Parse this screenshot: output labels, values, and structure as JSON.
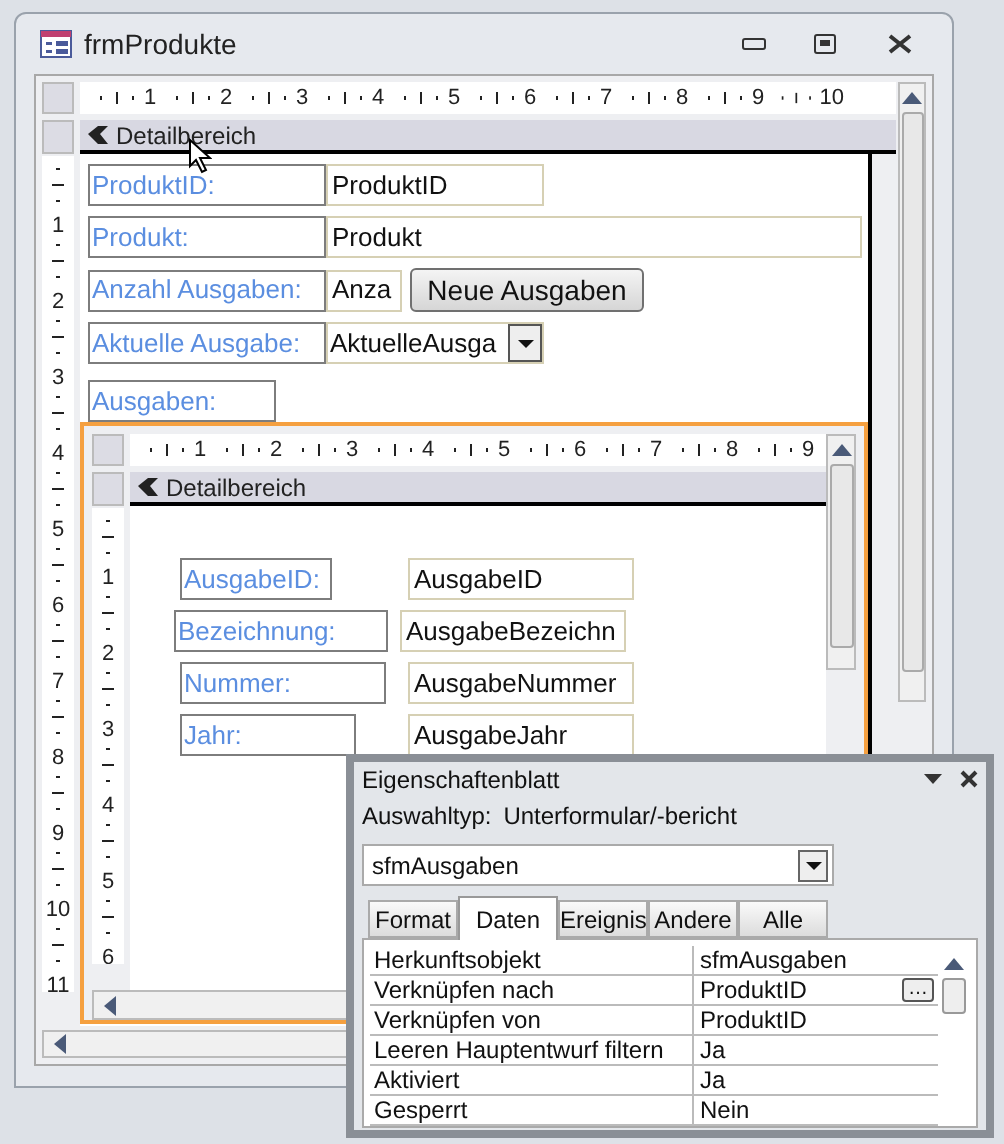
{
  "window": {
    "title": "frmProdukte"
  },
  "main_form": {
    "ruler_h": [
      "1",
      "2",
      "3",
      "4",
      "5",
      "6",
      "7",
      "8",
      "9",
      "10"
    ],
    "ruler_v": [
      "1",
      "2",
      "3",
      "4",
      "5",
      "6",
      "7",
      "8",
      "9",
      "10",
      "11"
    ],
    "section": "Detailbereich",
    "controls": [
      {
        "kind": "field",
        "label": "ProduktID:",
        "value": "ProduktID"
      },
      {
        "kind": "field",
        "label": "Produkt:",
        "value": "Produkt"
      },
      {
        "kind": "field_button",
        "label": "Anzahl Ausgaben:",
        "value": "Anza",
        "button": "Neue Ausgaben"
      },
      {
        "kind": "combo",
        "label": "Aktuelle Ausgabe:",
        "value": "AktuelleAusga"
      },
      {
        "kind": "label",
        "label": "Ausgaben:"
      }
    ]
  },
  "subform": {
    "ruler_h": [
      "1",
      "2",
      "3",
      "4",
      "5",
      "6",
      "7",
      "8",
      "9"
    ],
    "ruler_v": [
      "1",
      "2",
      "3",
      "4",
      "5",
      "6"
    ],
    "section": "Detailbereich",
    "controls": [
      {
        "label": "AusgabeID:",
        "value": "AusgabeID"
      },
      {
        "label": "Bezeichnung:",
        "value": "AusgabeBezeichn"
      },
      {
        "label": "Nummer:",
        "value": "AusgabeNummer"
      },
      {
        "label": "Jahr:",
        "value": "AusgabeJahr"
      }
    ]
  },
  "property_sheet": {
    "title": "Eigenschaftenblatt",
    "selection_label": "Auswahltyp:",
    "selection_type": "Unterformular/-bericht",
    "object": "sfmAusgaben",
    "tabs": [
      {
        "label": "Format",
        "selected": false
      },
      {
        "label": "Daten",
        "selected": true
      },
      {
        "label": "Ereignis",
        "selected": false
      },
      {
        "label": "Andere",
        "selected": false
      },
      {
        "label": "Alle",
        "selected": false
      }
    ],
    "rows": [
      {
        "name": "Herkunftsobjekt",
        "value": "sfmAusgaben"
      },
      {
        "name": "Verknüpfen nach",
        "value": "ProduktID",
        "button": "…"
      },
      {
        "name": "Verknüpfen von",
        "value": "ProduktID"
      },
      {
        "name": "Leeren Hauptentwurf filtern",
        "value": "Ja"
      },
      {
        "name": "Aktiviert",
        "value": "Ja"
      },
      {
        "name": "Gesperrt",
        "value": "Nein"
      }
    ]
  }
}
